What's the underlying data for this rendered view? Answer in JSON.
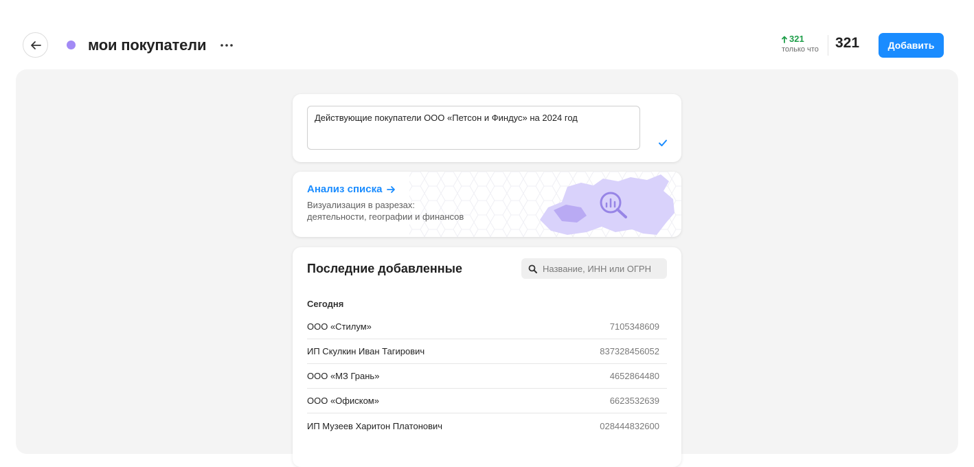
{
  "colors": {
    "accent": "#1a8cff",
    "dot": "#a28af5",
    "delta": "#1f9e4a",
    "map_fill": "#d9d2fb",
    "map_dark": "#b9aaf3"
  },
  "header": {
    "back_icon": "arrow-left-icon",
    "title": "мои покупатели",
    "more_icon": "more-horizontal-icon",
    "delta_value": "321",
    "delta_label": "только что",
    "total": "321",
    "add_label": "Добавить"
  },
  "description": {
    "value": "Действующие покупатели ООО «Петсон и Финдус» на 2024 год",
    "check_icon": "check-icon"
  },
  "analysis": {
    "title": "Анализ списка",
    "subtitle_line1": "Визуализация в разрезах:",
    "subtitle_line2": "деятельности, географии и финансов",
    "icon": "map-analytics-icon"
  },
  "recent": {
    "title": "Последние добавленные",
    "search_placeholder": "Название, ИНН или ОГРН",
    "section": "Сегодня",
    "items": [
      {
        "name": "ООО «Стилум»",
        "inn": "7105348609"
      },
      {
        "name": "ИП Скулкин Иван Тагирович",
        "inn": "837328456052"
      },
      {
        "name": "ООО «МЗ Грань»",
        "inn": "4652864480"
      },
      {
        "name": "ООО «Офиском»",
        "inn": "6623532639"
      },
      {
        "name": "ИП Музеев Харитон Платонович",
        "inn": "028444832600"
      }
    ]
  }
}
